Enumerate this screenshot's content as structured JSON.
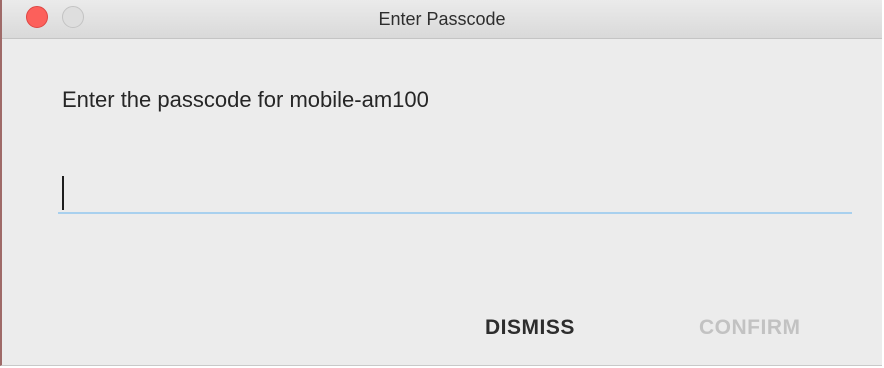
{
  "window": {
    "title": "Enter Passcode"
  },
  "dialog": {
    "prompt": "Enter the passcode for mobile-am100",
    "passcode_value": "",
    "buttons": {
      "dismiss_label": "DISMISS",
      "confirm_label": "CONFIRM"
    }
  },
  "colors": {
    "close_button": "#fc605b",
    "field_underline_focused": "#a8d0ee",
    "confirm_disabled_text": "#c2c2c2",
    "background": "#ececec"
  },
  "icons": {
    "close": "close-icon",
    "minimize": "minimize-icon"
  }
}
